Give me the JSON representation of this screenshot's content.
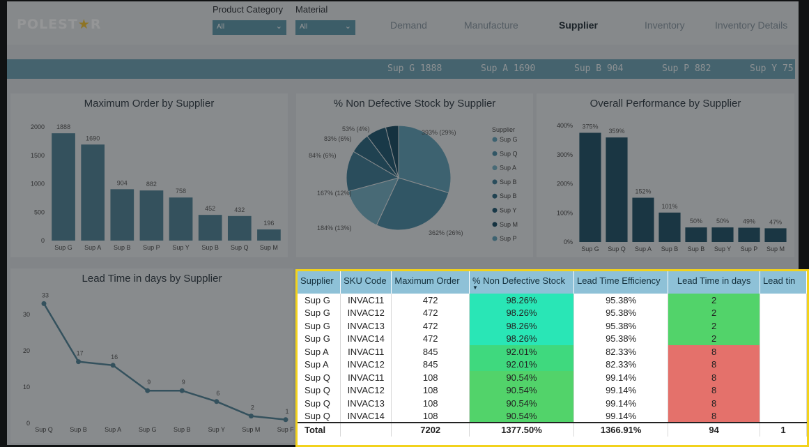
{
  "header": {
    "logo": "POLEST",
    "logo_star": "★",
    "logo_end": "R",
    "filters": [
      {
        "label": "Product Category",
        "value": "All"
      },
      {
        "label": "Material",
        "value": "All"
      }
    ],
    "nav": [
      "Demand",
      "Manufacture",
      "Supplier",
      "Inventory",
      "Inventory Details"
    ],
    "active_nav": "Supplier"
  },
  "ticker": [
    "Sup G 1888",
    "Sup A 1690",
    "Sup B 904",
    "Sup P 882",
    "Sup Y 75"
  ],
  "colors": {
    "bar": "#4f8295",
    "bar_dark": "#1f5067",
    "ticker": "#6ea3b5",
    "highlight": "#f2d21c"
  },
  "chart_data": [
    {
      "type": "bar",
      "title": "Maximum Order by Supplier",
      "categories": [
        "Sup G",
        "Sup A",
        "Sup B",
        "Sup P",
        "Sup Y",
        "Sup B",
        "Sup Q",
        "Sup M"
      ],
      "values": [
        1888,
        1690,
        904,
        882,
        758,
        452,
        432,
        196
      ],
      "ylim": [
        0,
        2000
      ],
      "yticks": [
        "0",
        "500",
        "1000",
        "1500",
        "2000"
      ]
    },
    {
      "type": "pie",
      "title": "% Non Defective Stock by Supplier",
      "slices": [
        {
          "label": "393% (29%)",
          "value": 393
        },
        {
          "label": "362% (26%)",
          "value": 362
        },
        {
          "label": "184% (13%)",
          "value": 184
        },
        {
          "label": "167% (12%)",
          "value": 167
        },
        {
          "label": "84% (6%)",
          "value": 84
        },
        {
          "label": "83% (6%)",
          "value": 83
        },
        {
          "label": "53% (4%)",
          "value": 53
        }
      ],
      "legend_title": "Supplier",
      "legend": [
        "Sup G",
        "Sup Q",
        "Sup A",
        "Sup B",
        "Sup B",
        "Sup Y",
        "Sup M",
        "Sup P"
      ]
    },
    {
      "type": "bar",
      "title": "Overall Performance by Supplier",
      "categories": [
        "Sup G",
        "Sup Q",
        "Sup A",
        "Sup B",
        "Sup B",
        "Sup Y",
        "Sup P",
        "Sup M"
      ],
      "values": [
        375,
        359,
        152,
        101,
        50,
        50,
        49,
        47
      ],
      "labels": [
        "375%",
        "359%",
        "152%",
        "101%",
        "50%",
        "50%",
        "49%",
        "47%"
      ],
      "ylim": [
        0,
        400
      ],
      "yticks": [
        "0%",
        "100%",
        "200%",
        "300%",
        "400%"
      ]
    },
    {
      "type": "line",
      "title": "Lead Time in days by Supplier",
      "categories": [
        "Sup Q",
        "Sup B",
        "Sup A",
        "Sup G",
        "Sup B",
        "Sup Y",
        "Sup M",
        "Sup P"
      ],
      "values": [
        33,
        17,
        16,
        9,
        9,
        6,
        2,
        1
      ],
      "ylim": [
        0,
        35
      ],
      "yticks": [
        "0",
        "10",
        "20",
        "30"
      ]
    }
  ],
  "table": {
    "columns": [
      "Supplier",
      "SKU Code",
      "Maximum Order",
      "% Non Defective Stock",
      "Lead Time Efficiency",
      "Lead Time in days",
      "Lead tin"
    ],
    "sort_indicator": "▼",
    "rows": [
      [
        "Sup G",
        "INVAC11",
        "472",
        "98.26%",
        "95.38%",
        "2",
        ""
      ],
      [
        "Sup G",
        "INVAC12",
        "472",
        "98.26%",
        "95.38%",
        "2",
        ""
      ],
      [
        "Sup G",
        "INVAC13",
        "472",
        "98.26%",
        "95.38%",
        "2",
        ""
      ],
      [
        "Sup G",
        "INVAC14",
        "472",
        "98.26%",
        "95.38%",
        "2",
        ""
      ],
      [
        "Sup A",
        "INVAC11",
        "845",
        "92.01%",
        "82.33%",
        "8",
        ""
      ],
      [
        "Sup A",
        "INVAC12",
        "845",
        "92.01%",
        "82.33%",
        "8",
        ""
      ],
      [
        "Sup Q",
        "INVAC11",
        "108",
        "90.54%",
        "99.14%",
        "8",
        ""
      ],
      [
        "Sup Q",
        "INVAC12",
        "108",
        "90.54%",
        "99.14%",
        "8",
        ""
      ],
      [
        "Sup Q",
        "INVAC13",
        "108",
        "90.54%",
        "99.14%",
        "8",
        ""
      ],
      [
        "Sup Q",
        "INVAC14",
        "108",
        "90.54%",
        "99.14%",
        "8",
        ""
      ]
    ],
    "total": [
      "Total",
      "",
      "7202",
      "1377.50%",
      "1366.91%",
      "94",
      "1"
    ]
  }
}
